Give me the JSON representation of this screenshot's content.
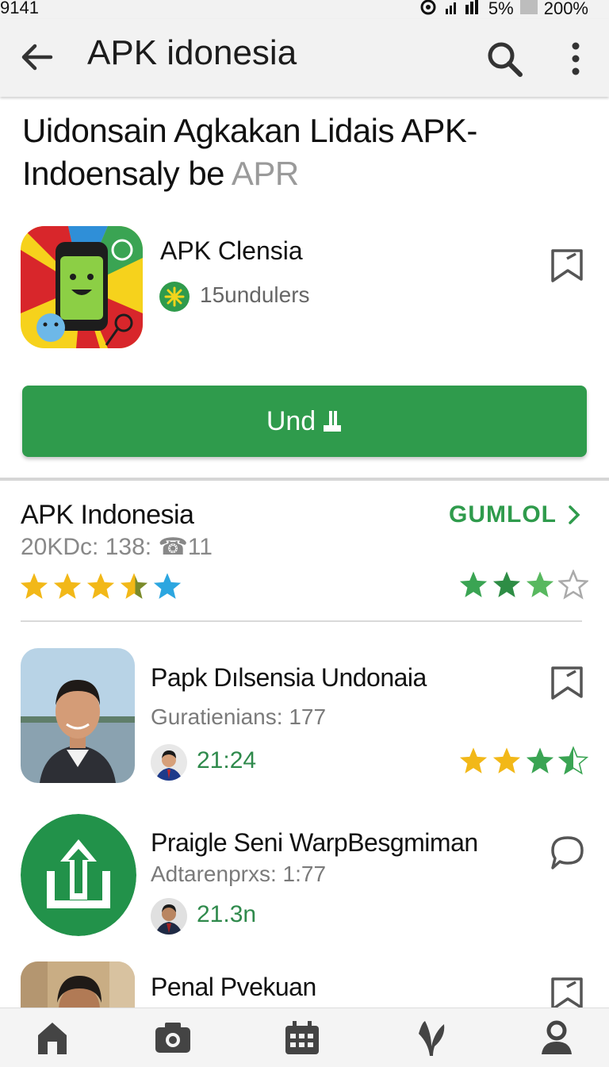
{
  "status_bar": {
    "time": "9141",
    "battery": "5%",
    "zoom": "200%"
  },
  "app_bar": {
    "title": "APK idonesia"
  },
  "headline": {
    "main": "Uidonsain Agkakan Lidais APK-Indoensaly be",
    "faint": "APR"
  },
  "app": {
    "name": "APK Clensia",
    "downloads": "15undulers"
  },
  "install_button": {
    "label": "Und"
  },
  "section": {
    "title": "APK Indonesia",
    "subtitle": "20KDc: 138: ☎11",
    "link_label": "GUMLOL",
    "left_rating": 4.5,
    "right_rating": 3.5
  },
  "list": [
    {
      "title": "Papk Dılsensia Undonaia",
      "subtitle": "Guratienians: 177",
      "meta": "21:24",
      "rating": 3.5
    },
    {
      "title": "Praigle Seni WarpBesgmiman",
      "subtitle": "Adtarenprxs: 1:77",
      "meta": "21.3n"
    },
    {
      "title": "Penal Pvekuan"
    }
  ],
  "colors": {
    "accent": "#2f9b4c",
    "star_gold": "#f2b818",
    "star_green": "#3aa453",
    "star_blue": "#2ca6e0"
  },
  "icons": [
    "back-arrow-icon",
    "search-icon",
    "more-vert-icon",
    "bookmark-icon",
    "home-icon",
    "camera-icon",
    "calendar-icon",
    "leaf-icon",
    "person-icon"
  ]
}
